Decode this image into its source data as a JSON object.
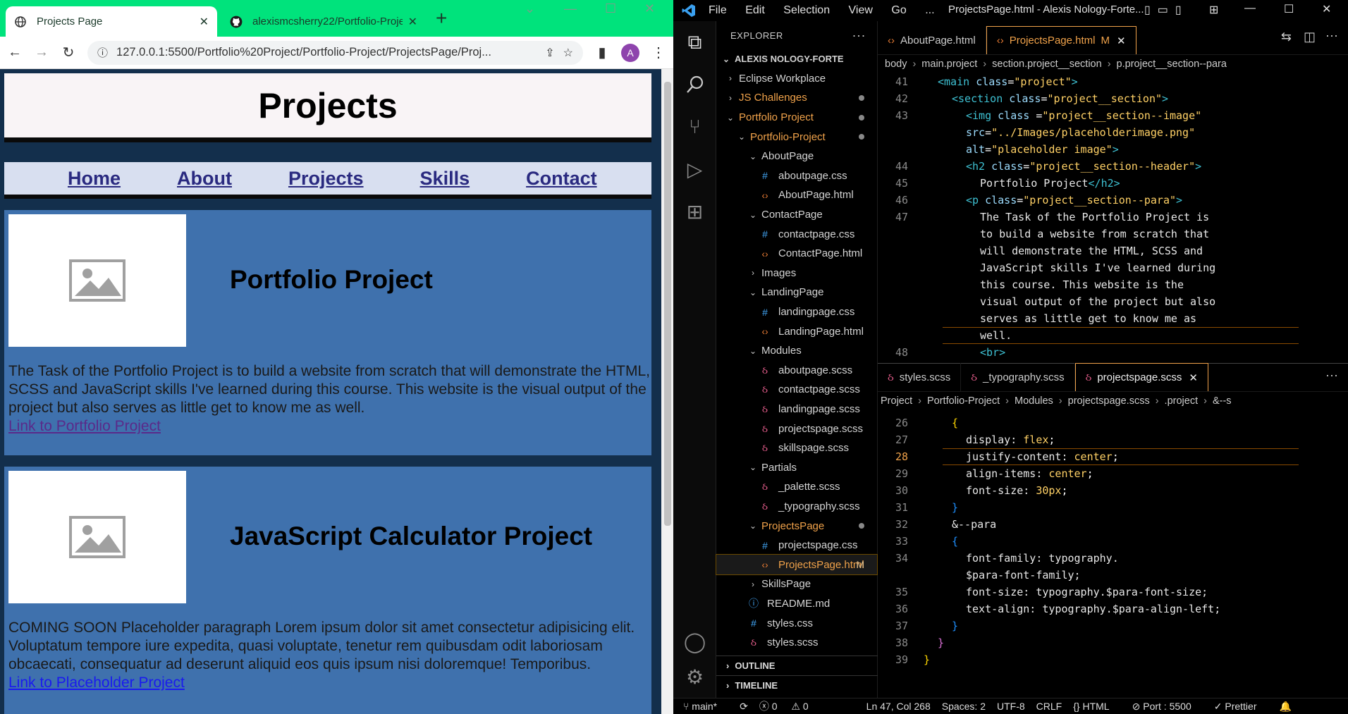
{
  "browser": {
    "tabs": [
      {
        "title": "Projects Page",
        "active": true
      },
      {
        "title": "alexismcsherry22/Portfolio-Proje",
        "active": false
      }
    ],
    "url": "127.0.0.1:5500/Portfolio%20Project/Portfolio-Project/ProjectsPage/Proj...",
    "profile_initial": "A",
    "page": {
      "title": "Projects",
      "nav": [
        "Home",
        "About",
        "Projects",
        "Skills",
        "Contact"
      ],
      "projects": [
        {
          "heading": "Portfolio Project",
          "text": "The Task of the Portfolio Project is to build a website from scratch that will demonstrate the HTML, SCSS and JavaScript skills I've learned during this course. This website is the visual output of the project but also serves as little get to know me as well.",
          "link": "Link to Portfolio Project"
        },
        {
          "heading": "JavaScript Calculator Project",
          "text": "COMING SOON Placeholder paragraph Lorem ipsum dolor sit amet consectetur adipisicing elit. Voluptatum tempore iure expedita, quasi voluptate, tenetur rem quibusdam odit laboriosam obcaecati, consequatur ad deserunt aliquid eos quis ipsum nisi doloremque! Temporibus.",
          "link": "Link to Placeholder Project"
        }
      ]
    }
  },
  "vscode": {
    "menu": [
      "File",
      "Edit",
      "Selection",
      "View",
      "Go",
      "..."
    ],
    "window_title": "ProjectsPage.html - Alexis Nology-Forte...",
    "explorer_label": "EXPLORER",
    "root": "ALEXIS NOLOGY-FORTE",
    "tree": [
      {
        "label": "Eclipse Workplace",
        "indent": 0,
        "type": "folder-closed"
      },
      {
        "label": "JS Challenges",
        "indent": 0,
        "type": "folder-closed",
        "dot": true,
        "color": "orange"
      },
      {
        "label": "Portfolio Project",
        "indent": 0,
        "type": "folder-open",
        "dot": true,
        "color": "orange"
      },
      {
        "label": "Portfolio-Project",
        "indent": 1,
        "type": "folder-open",
        "dot": true,
        "color": "orange"
      },
      {
        "label": "AboutPage",
        "indent": 2,
        "type": "folder-open"
      },
      {
        "label": "aboutpage.css",
        "indent": 3,
        "type": "css"
      },
      {
        "label": "AboutPage.html",
        "indent": 3,
        "type": "html"
      },
      {
        "label": "ContactPage",
        "indent": 2,
        "type": "folder-open"
      },
      {
        "label": "contactpage.css",
        "indent": 3,
        "type": "css"
      },
      {
        "label": "ContactPage.html",
        "indent": 3,
        "type": "html"
      },
      {
        "label": "Images",
        "indent": 2,
        "type": "folder-closed"
      },
      {
        "label": "LandingPage",
        "indent": 2,
        "type": "folder-open"
      },
      {
        "label": "landingpage.css",
        "indent": 3,
        "type": "css"
      },
      {
        "label": "LandingPage.html",
        "indent": 3,
        "type": "html"
      },
      {
        "label": "Modules",
        "indent": 2,
        "type": "folder-open"
      },
      {
        "label": "aboutpage.scss",
        "indent": 3,
        "type": "scss"
      },
      {
        "label": "contactpage.scss",
        "indent": 3,
        "type": "scss"
      },
      {
        "label": "landingpage.scss",
        "indent": 3,
        "type": "scss"
      },
      {
        "label": "projectspage.scss",
        "indent": 3,
        "type": "scss"
      },
      {
        "label": "skillspage.scss",
        "indent": 3,
        "type": "scss"
      },
      {
        "label": "Partials",
        "indent": 2,
        "type": "folder-open"
      },
      {
        "label": "_palette.scss",
        "indent": 3,
        "type": "scss"
      },
      {
        "label": "_typography.scss",
        "indent": 3,
        "type": "scss"
      },
      {
        "label": "ProjectsPage",
        "indent": 2,
        "type": "folder-open",
        "dot": true,
        "color": "orange"
      },
      {
        "label": "projectspage.css",
        "indent": 3,
        "type": "css"
      },
      {
        "label": "ProjectsPage.html",
        "indent": 3,
        "type": "html",
        "selected": true,
        "modified": "M",
        "color": "orange"
      },
      {
        "label": "SkillsPage",
        "indent": 2,
        "type": "folder-closed"
      },
      {
        "label": "README.md",
        "indent": 2,
        "type": "md"
      },
      {
        "label": "styles.css",
        "indent": 2,
        "type": "css"
      },
      {
        "label": "styles.scss",
        "indent": 2,
        "type": "scss"
      }
    ],
    "panels": [
      "OUTLINE",
      "TIMELINE"
    ],
    "top_tabs": [
      {
        "label": "AboutPage.html",
        "active": false
      },
      {
        "label": "ProjectsPage.html",
        "active": true,
        "modified": "M"
      }
    ],
    "top_crumbs": [
      "body",
      "main.project",
      "section.project__section",
      "p.project__section--para"
    ],
    "bottom_tabs": [
      {
        "label": "styles.scss",
        "active": false
      },
      {
        "label": "_typography.scss",
        "active": false
      },
      {
        "label": "projectspage.scss",
        "active": true
      }
    ],
    "bottom_crumbs": [
      "Project",
      "Portfolio-Project",
      "Modules",
      "projectspage.scss",
      ".project",
      "&--s"
    ],
    "status": {
      "branch": "main*",
      "errors": "0",
      "warnings": "0",
      "position": "Ln 47, Col 268",
      "spaces": "Spaces: 2",
      "encoding": "UTF-8",
      "eol": "CRLF",
      "language": "HTML",
      "port": "Port : 5500",
      "formatter": "Prettier"
    },
    "top_code": [
      {
        "n": "41",
        "indent": 1,
        "parts": [
          [
            "tg",
            "<main "
          ],
          [
            "at",
            "class"
          ],
          [
            "sy",
            "="
          ],
          [
            "st",
            "\"project\""
          ],
          [
            "tg",
            ">"
          ]
        ]
      },
      {
        "n": "42",
        "indent": 2,
        "parts": [
          [
            "tg",
            "<section "
          ],
          [
            "at",
            "class"
          ],
          [
            "sy",
            "="
          ],
          [
            "st",
            "\"project__section\""
          ],
          [
            "tg",
            ">"
          ]
        ]
      },
      {
        "n": "43",
        "indent": 3,
        "parts": [
          [
            "tg",
            "<img "
          ],
          [
            "at",
            "class "
          ],
          [
            "sy",
            "="
          ],
          [
            "st",
            "\"project__section--image\""
          ]
        ]
      },
      {
        "n": "",
        "indent": 3,
        "parts": [
          [
            "at",
            "src"
          ],
          [
            "sy",
            "="
          ],
          [
            "st",
            "\"../Images/placeholderimage.png\""
          ]
        ]
      },
      {
        "n": "",
        "indent": 3,
        "parts": [
          [
            "at",
            "alt"
          ],
          [
            "sy",
            "="
          ],
          [
            "st",
            "\"placeholder image\""
          ],
          [
            "tg",
            ">"
          ]
        ]
      },
      {
        "n": "44",
        "indent": 3,
        "parts": [
          [
            "tg",
            "<h2 "
          ],
          [
            "at",
            "class"
          ],
          [
            "sy",
            "="
          ],
          [
            "st",
            "\"project__section--header\""
          ],
          [
            "tg",
            ">"
          ]
        ]
      },
      {
        "n": "45",
        "indent": 4,
        "parts": [
          [
            "tx",
            "Portfolio Project"
          ],
          [
            "tg",
            "</h2>"
          ]
        ]
      },
      {
        "n": "46",
        "indent": 3,
        "parts": [
          [
            "tg",
            "<p "
          ],
          [
            "at",
            "class"
          ],
          [
            "sy",
            "="
          ],
          [
            "st",
            "\"project__section--para\""
          ],
          [
            "tg",
            ">"
          ]
        ]
      },
      {
        "n": "47",
        "indent": 4,
        "parts": [
          [
            "tx",
            "The Task of the Portfolio Project is"
          ]
        ]
      },
      {
        "n": "",
        "indent": 4,
        "parts": [
          [
            "tx",
            "to build a website from scratch that"
          ]
        ]
      },
      {
        "n": "",
        "indent": 4,
        "parts": [
          [
            "tx",
            "will demonstrate the HTML, SCSS and"
          ]
        ]
      },
      {
        "n": "",
        "indent": 4,
        "parts": [
          [
            "tx",
            "JavaScript skills I've learned during"
          ]
        ]
      },
      {
        "n": "",
        "indent": 4,
        "parts": [
          [
            "tx",
            "this course. This website is the"
          ]
        ]
      },
      {
        "n": "",
        "indent": 4,
        "parts": [
          [
            "tx",
            "visual output of the project but also"
          ]
        ]
      },
      {
        "n": "",
        "indent": 4,
        "parts": [
          [
            "tx",
            "serves as little get to know me as"
          ]
        ]
      },
      {
        "n": "",
        "indent": 4,
        "parts": [
          [
            "tx",
            "well."
          ]
        ]
      },
      {
        "n": "48",
        "indent": 4,
        "parts": [
          [
            "tg",
            "<br>"
          ]
        ]
      }
    ],
    "bottom_code": [
      {
        "n": "26",
        "indent": 2,
        "parts": [
          [
            "br1",
            "{"
          ]
        ]
      },
      {
        "n": "27",
        "indent": 3,
        "parts": [
          [
            "pr",
            "display: "
          ],
          [
            "vl",
            "flex"
          ],
          [
            "sy",
            ";"
          ]
        ]
      },
      {
        "n": "28",
        "indent": 3,
        "parts": [
          [
            "pr",
            "justify-content: "
          ],
          [
            "vl",
            "center"
          ],
          [
            "sy",
            ";"
          ]
        ]
      },
      {
        "n": "29",
        "indent": 3,
        "parts": [
          [
            "pr",
            "align-items: "
          ],
          [
            "vl",
            "center"
          ],
          [
            "sy",
            ";"
          ]
        ]
      },
      {
        "n": "30",
        "indent": 3,
        "parts": [
          [
            "pr",
            "font-size: "
          ],
          [
            "vl",
            "30px"
          ],
          [
            "sy",
            ";"
          ]
        ]
      },
      {
        "n": "31",
        "indent": 2,
        "parts": [
          [
            "br3",
            "}"
          ]
        ]
      },
      {
        "n": "32",
        "indent": 2,
        "parts": [
          [
            "pr",
            "&--para"
          ]
        ]
      },
      {
        "n": "33",
        "indent": 2,
        "parts": [
          [
            "br3",
            "{"
          ]
        ]
      },
      {
        "n": "34",
        "indent": 3,
        "parts": [
          [
            "pr",
            "font-family: typography."
          ]
        ]
      },
      {
        "n": "",
        "indent": 3,
        "parts": [
          [
            "pr",
            "$para-font-family;"
          ]
        ]
      },
      {
        "n": "35",
        "indent": 3,
        "parts": [
          [
            "pr",
            "font-size: typography.$para-font-size;"
          ]
        ]
      },
      {
        "n": "36",
        "indent": 3,
        "parts": [
          [
            "pr",
            "text-align: typography.$para-align-left;"
          ]
        ]
      },
      {
        "n": "37",
        "indent": 2,
        "parts": [
          [
            "br3",
            "}"
          ]
        ]
      },
      {
        "n": "38",
        "indent": 1,
        "parts": [
          [
            "br2",
            "}"
          ]
        ]
      },
      {
        "n": "39",
        "indent": 0,
        "parts": [
          [
            "br1",
            "}"
          ]
        ]
      }
    ]
  }
}
